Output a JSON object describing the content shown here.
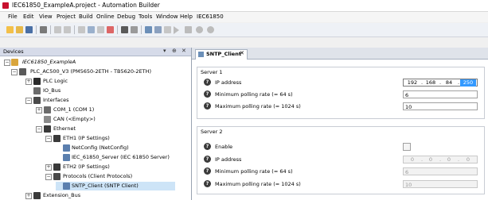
{
  "window": {
    "title": "IEC61850_ExampleA.project - Automation Builder"
  },
  "menu": [
    "File",
    "Edit",
    "View",
    "Project",
    "Build",
    "Online",
    "Debug",
    "Tools",
    "Window",
    "Help",
    "IEC61850"
  ],
  "devices_panel": {
    "title": "Devices",
    "controls": [
      "▾",
      "⊕",
      "✕"
    ]
  },
  "tree": [
    {
      "label": "IEC61850_ExampleA",
      "italic": true
    },
    {
      "label": "PLC_AC500_V3 (PM5650-2ETH - TB5620-2ETH)"
    },
    {
      "label": "PLC Logic"
    },
    {
      "label": "IO_Bus"
    },
    {
      "label": "Interfaces"
    },
    {
      "label": "COM_1 (COM 1)"
    },
    {
      "label": "CAN (<Empty>)"
    },
    {
      "label": "Ethernet"
    },
    {
      "label": "ETH1 (IP Settings)"
    },
    {
      "label": "NetConfig (NetConfig)"
    },
    {
      "label": "IEC_61850_Server (IEC 61850 Server)"
    },
    {
      "label": "ETH2 (IP Settings)"
    },
    {
      "label": "Protocols (Client Protocols)"
    },
    {
      "label": "SNTP_Client (SNTP Client)"
    },
    {
      "label": "Extension_Bus"
    }
  ],
  "tab": {
    "label": "SNTP_Client",
    "close": "✕"
  },
  "server1": {
    "title": "Server 1",
    "ip_label": "IP address",
    "ip": [
      "192",
      "168",
      "84",
      "250"
    ],
    "min_label": "Minimum polling rate (= 64 s)",
    "min_value": "6",
    "max_label": "Maximum polling rate (= 1024 s)",
    "max_value": "10"
  },
  "server2": {
    "title": "Server 2",
    "enable_label": "Enable",
    "ip_label": "IP address",
    "ip": [
      "0",
      "0",
      "0",
      "0"
    ],
    "min_label": "Minimum polling rate (= 64 s)",
    "min_value": "6",
    "max_label": "Maximum polling rate (= 1024 s)",
    "max_value": "10"
  },
  "help_glyph": "?",
  "colors": {
    "selection": "#cde4f7",
    "ip_highlight": "#3399ff"
  }
}
